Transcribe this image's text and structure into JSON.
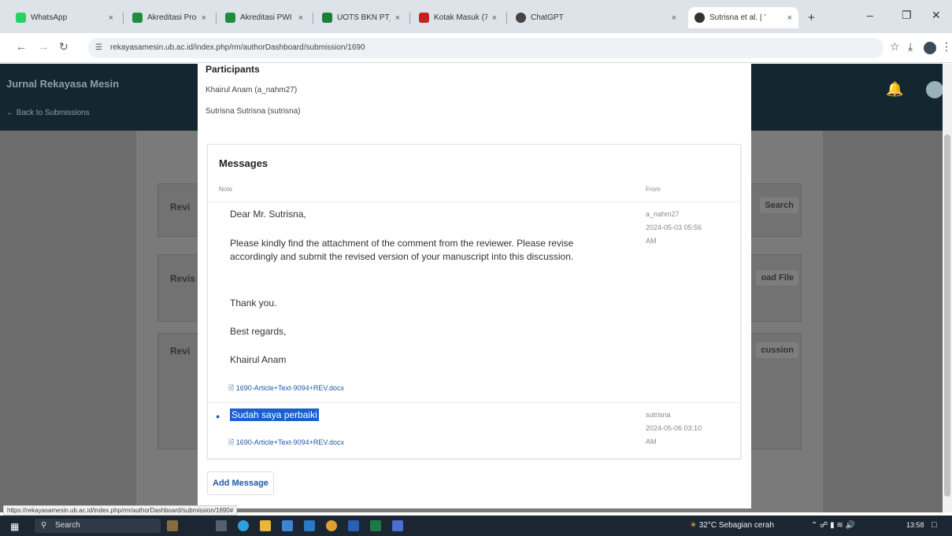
{
  "browser": {
    "tabs": [
      {
        "label": "WhatsApp",
        "color": "#25d366",
        "close": "×"
      },
      {
        "label": "Akreditasi Prod",
        "color": "#1e8e3e",
        "close": "×"
      },
      {
        "label": "Akreditasi PWI",
        "color": "#1e8e3e",
        "close": "×"
      },
      {
        "label": "UOTS BKN PT_F",
        "color": "#188038",
        "close": "×"
      },
      {
        "label": "Kotak Masuk (7",
        "color": "#c5221f",
        "close": "×"
      },
      {
        "label": "ChatGPT",
        "color": "#444444",
        "close": "×"
      },
      {
        "label": "Sutrisna et al. | ’",
        "color": "#333333",
        "close": "×"
      }
    ],
    "new_tab": "+",
    "url": "rekayasamesin.ub.ac.id/index.php/rm/authorDashboard/submission/1690",
    "status_url": "https://rekayasamesin.ub.ac.id/index.php/rm/authorDashboard/submission/1690#"
  },
  "app": {
    "journal": "Jurnal Rekayasa Mesin",
    "back": "← Back to Submissions"
  },
  "background": {
    "labels": [
      "Revi",
      "Revis",
      "Revi"
    ],
    "buttons": [
      "Search",
      "oad File",
      "cussion"
    ]
  },
  "modal": {
    "participants_title": "Participants",
    "participants": [
      "Khairul Anam (a_nahm27)",
      "Sutrisna Sutrisna (sutrisna)"
    ],
    "messages_title": "Messages",
    "col_note": "Note",
    "col_from": "From",
    "m1": {
      "lines": [
        "Dear Mr. Sutrisna,",
        "Please kindly find the attachment of the comment from the reviewer. Please revise accordingly and submit the revised version of your manuscript into this discussion.",
        "Thank you.",
        "Best regards,",
        "Khairul Anam"
      ],
      "attachment": "1690-Article+Text-9094+REV.docx",
      "from": "a_nahm27",
      "date": "2024-05-03 05:56",
      "ampm": "AM"
    },
    "m2": {
      "text": "Sudah saya perbaiki",
      "attachment": "1690-Article+Text-9094+REV.docx",
      "from": "sutrisna",
      "date": "2024-05-06 03:10",
      "ampm": "AM"
    },
    "add_message": "Add Message"
  },
  "taskbar": {
    "search": "Search",
    "weather": "32°C  Sebagian cerah",
    "time": "13:58"
  }
}
